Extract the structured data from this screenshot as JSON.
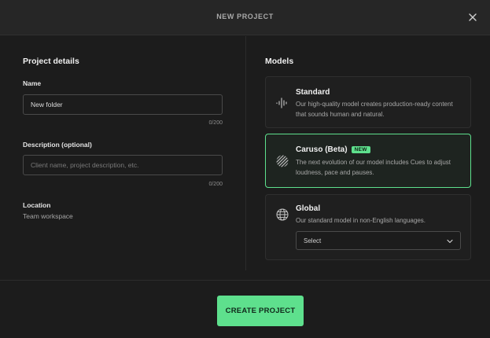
{
  "header": {
    "title": "NEW PROJECT",
    "close_icon": "close-icon"
  },
  "project_details": {
    "section_title": "Project details",
    "name": {
      "label": "Name",
      "value": "New folder",
      "counter": "0/200"
    },
    "description": {
      "label": "Description (optional)",
      "placeholder": "Client name, project description, etc.",
      "counter": "0/200"
    },
    "location": {
      "label": "Location",
      "value": "Team workspace"
    }
  },
  "models": {
    "section_title": "Models",
    "items": [
      {
        "icon": "waveform-icon",
        "name": "Standard",
        "description": "Our high-quality model creates production-ready content that sounds human and natural.",
        "selected": false
      },
      {
        "icon": "hatched-circle-icon",
        "name": "Caruso (Beta)",
        "badge": "NEW",
        "description": "The next evolution of our model includes Cues to adjust loudness, pace and pauses.",
        "selected": true
      },
      {
        "icon": "globe-icon",
        "name": "Global",
        "description": "Our standard model in non-English languages.",
        "select_value": "Select",
        "selected": false
      }
    ]
  },
  "footer": {
    "create_label": "CREATE PROJECT"
  },
  "colors": {
    "accent": "#5ee08d",
    "background": "#1c1c1c",
    "header": "#262626"
  }
}
